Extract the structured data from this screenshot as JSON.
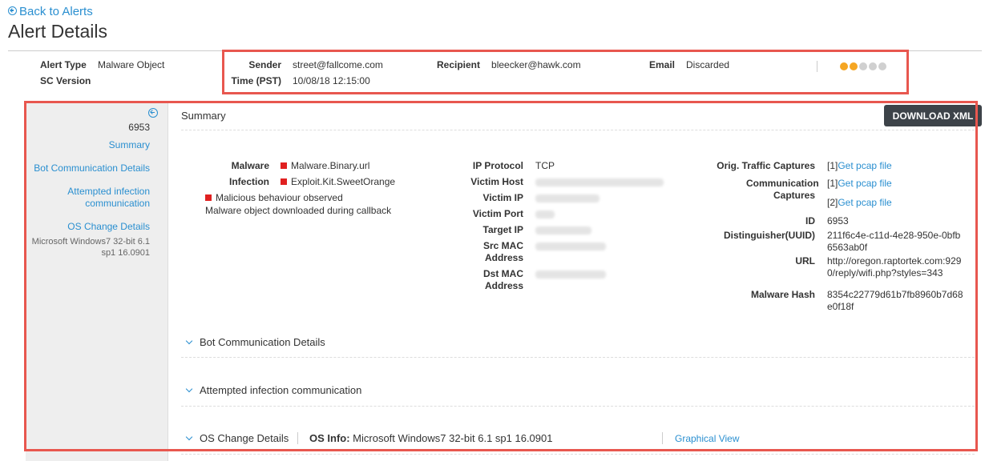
{
  "back_link": "Back to Alerts",
  "page_title": "Alert Details",
  "header": {
    "alert_type_label": "Alert Type",
    "alert_type_value": "Malware Object",
    "sc_version_label": "SC Version",
    "sender_label": "Sender",
    "sender_value": "street@fallcome.com",
    "time_label": "Time (PST)",
    "time_value": "10/08/18 12:15:00",
    "recipient_label": "Recipient",
    "recipient_value": "bleecker@hawk.com",
    "email_label": "Email",
    "email_value": "Discarded",
    "severity_dots": [
      "#f5a623",
      "#f5a623",
      "#d0d0d0",
      "#d0d0d0",
      "#d0d0d0"
    ]
  },
  "sidebar": {
    "id": "6953",
    "links": [
      "Summary",
      "Bot Communication Details",
      "Attempted infection communication",
      "OS Change Details"
    ],
    "os_text": "Microsoft Windows7 32-bit 6.1 sp1 16.0901"
  },
  "summary": {
    "title": "Summary",
    "download_label": "DOWNLOAD XML",
    "malware_label": "Malware",
    "malware_value": "Malware.Binary.url",
    "infection_label": "Infection",
    "infection_value": "Exploit.Kit.SweetOrange",
    "malicious_text": "Malicious behaviour observed",
    "downloaded_text": "Malware object downloaded during callback",
    "ip_protocol_label": "IP Protocol",
    "ip_protocol_value": "TCP",
    "victim_host_label": "Victim Host",
    "victim_ip_label": "Victim IP",
    "victim_port_label": "Victim Port",
    "target_ip_label": "Target IP",
    "src_mac_label": "Src MAC Address",
    "dst_mac_label": "Dst MAC Address",
    "orig_traffic_label": "Orig. Traffic Captures",
    "orig_traffic_prefix": "[1]",
    "comm_captures_label": "Communication Captures",
    "comm_prefix_1": "[1]",
    "comm_prefix_2": "[2]",
    "pcap_link": "Get pcap file",
    "id_label": "ID",
    "id_value": "6953",
    "uuid_label": "Distinguisher(UUID)",
    "uuid_value": "211f6c4e-c11d-4e28-950e-0bfb6563ab0f",
    "url_label": "URL",
    "url_value": "http://oregon.raptortek.com:9290/reply/wifi.php?styles=343",
    "hash_label": "Malware Hash",
    "hash_value": "8354c22779d61b7fb8960b7d68e0f18f"
  },
  "sections": {
    "bot": "Bot Communication Details",
    "attempted": "Attempted infection communication",
    "os": "OS Change Details",
    "os_info_label": "OS Info:",
    "os_info_value": "Microsoft Windows7 32-bit 6.1 sp1 16.0901",
    "graphical_view": "Graphical View"
  }
}
